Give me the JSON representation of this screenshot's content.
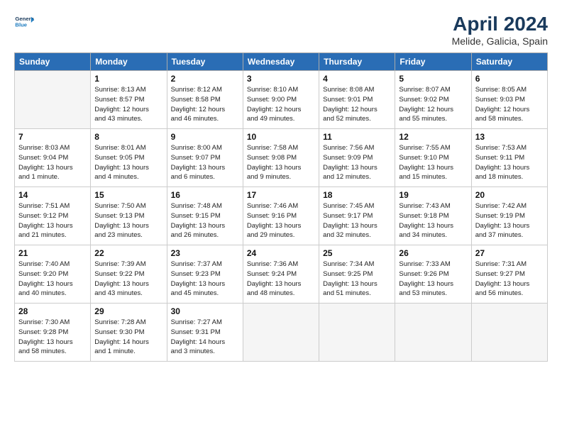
{
  "header": {
    "logo_general": "General",
    "logo_blue": "Blue",
    "title": "April 2024",
    "subtitle": "Melide, Galicia, Spain"
  },
  "days_of_week": [
    "Sunday",
    "Monday",
    "Tuesday",
    "Wednesday",
    "Thursday",
    "Friday",
    "Saturday"
  ],
  "weeks": [
    [
      {
        "day": "",
        "info": ""
      },
      {
        "day": "1",
        "info": "Sunrise: 8:13 AM\nSunset: 8:57 PM\nDaylight: 12 hours\nand 43 minutes."
      },
      {
        "day": "2",
        "info": "Sunrise: 8:12 AM\nSunset: 8:58 PM\nDaylight: 12 hours\nand 46 minutes."
      },
      {
        "day": "3",
        "info": "Sunrise: 8:10 AM\nSunset: 9:00 PM\nDaylight: 12 hours\nand 49 minutes."
      },
      {
        "day": "4",
        "info": "Sunrise: 8:08 AM\nSunset: 9:01 PM\nDaylight: 12 hours\nand 52 minutes."
      },
      {
        "day": "5",
        "info": "Sunrise: 8:07 AM\nSunset: 9:02 PM\nDaylight: 12 hours\nand 55 minutes."
      },
      {
        "day": "6",
        "info": "Sunrise: 8:05 AM\nSunset: 9:03 PM\nDaylight: 12 hours\nand 58 minutes."
      }
    ],
    [
      {
        "day": "7",
        "info": "Sunrise: 8:03 AM\nSunset: 9:04 PM\nDaylight: 13 hours\nand 1 minute."
      },
      {
        "day": "8",
        "info": "Sunrise: 8:01 AM\nSunset: 9:05 PM\nDaylight: 13 hours\nand 4 minutes."
      },
      {
        "day": "9",
        "info": "Sunrise: 8:00 AM\nSunset: 9:07 PM\nDaylight: 13 hours\nand 6 minutes."
      },
      {
        "day": "10",
        "info": "Sunrise: 7:58 AM\nSunset: 9:08 PM\nDaylight: 13 hours\nand 9 minutes."
      },
      {
        "day": "11",
        "info": "Sunrise: 7:56 AM\nSunset: 9:09 PM\nDaylight: 13 hours\nand 12 minutes."
      },
      {
        "day": "12",
        "info": "Sunrise: 7:55 AM\nSunset: 9:10 PM\nDaylight: 13 hours\nand 15 minutes."
      },
      {
        "day": "13",
        "info": "Sunrise: 7:53 AM\nSunset: 9:11 PM\nDaylight: 13 hours\nand 18 minutes."
      }
    ],
    [
      {
        "day": "14",
        "info": "Sunrise: 7:51 AM\nSunset: 9:12 PM\nDaylight: 13 hours\nand 21 minutes."
      },
      {
        "day": "15",
        "info": "Sunrise: 7:50 AM\nSunset: 9:13 PM\nDaylight: 13 hours\nand 23 minutes."
      },
      {
        "day": "16",
        "info": "Sunrise: 7:48 AM\nSunset: 9:15 PM\nDaylight: 13 hours\nand 26 minutes."
      },
      {
        "day": "17",
        "info": "Sunrise: 7:46 AM\nSunset: 9:16 PM\nDaylight: 13 hours\nand 29 minutes."
      },
      {
        "day": "18",
        "info": "Sunrise: 7:45 AM\nSunset: 9:17 PM\nDaylight: 13 hours\nand 32 minutes."
      },
      {
        "day": "19",
        "info": "Sunrise: 7:43 AM\nSunset: 9:18 PM\nDaylight: 13 hours\nand 34 minutes."
      },
      {
        "day": "20",
        "info": "Sunrise: 7:42 AM\nSunset: 9:19 PM\nDaylight: 13 hours\nand 37 minutes."
      }
    ],
    [
      {
        "day": "21",
        "info": "Sunrise: 7:40 AM\nSunset: 9:20 PM\nDaylight: 13 hours\nand 40 minutes."
      },
      {
        "day": "22",
        "info": "Sunrise: 7:39 AM\nSunset: 9:22 PM\nDaylight: 13 hours\nand 43 minutes."
      },
      {
        "day": "23",
        "info": "Sunrise: 7:37 AM\nSunset: 9:23 PM\nDaylight: 13 hours\nand 45 minutes."
      },
      {
        "day": "24",
        "info": "Sunrise: 7:36 AM\nSunset: 9:24 PM\nDaylight: 13 hours\nand 48 minutes."
      },
      {
        "day": "25",
        "info": "Sunrise: 7:34 AM\nSunset: 9:25 PM\nDaylight: 13 hours\nand 51 minutes."
      },
      {
        "day": "26",
        "info": "Sunrise: 7:33 AM\nSunset: 9:26 PM\nDaylight: 13 hours\nand 53 minutes."
      },
      {
        "day": "27",
        "info": "Sunrise: 7:31 AM\nSunset: 9:27 PM\nDaylight: 13 hours\nand 56 minutes."
      }
    ],
    [
      {
        "day": "28",
        "info": "Sunrise: 7:30 AM\nSunset: 9:28 PM\nDaylight: 13 hours\nand 58 minutes."
      },
      {
        "day": "29",
        "info": "Sunrise: 7:28 AM\nSunset: 9:30 PM\nDaylight: 14 hours\nand 1 minute."
      },
      {
        "day": "30",
        "info": "Sunrise: 7:27 AM\nSunset: 9:31 PM\nDaylight: 14 hours\nand 3 minutes."
      },
      {
        "day": "",
        "info": ""
      },
      {
        "day": "",
        "info": ""
      },
      {
        "day": "",
        "info": ""
      },
      {
        "day": "",
        "info": ""
      }
    ]
  ]
}
